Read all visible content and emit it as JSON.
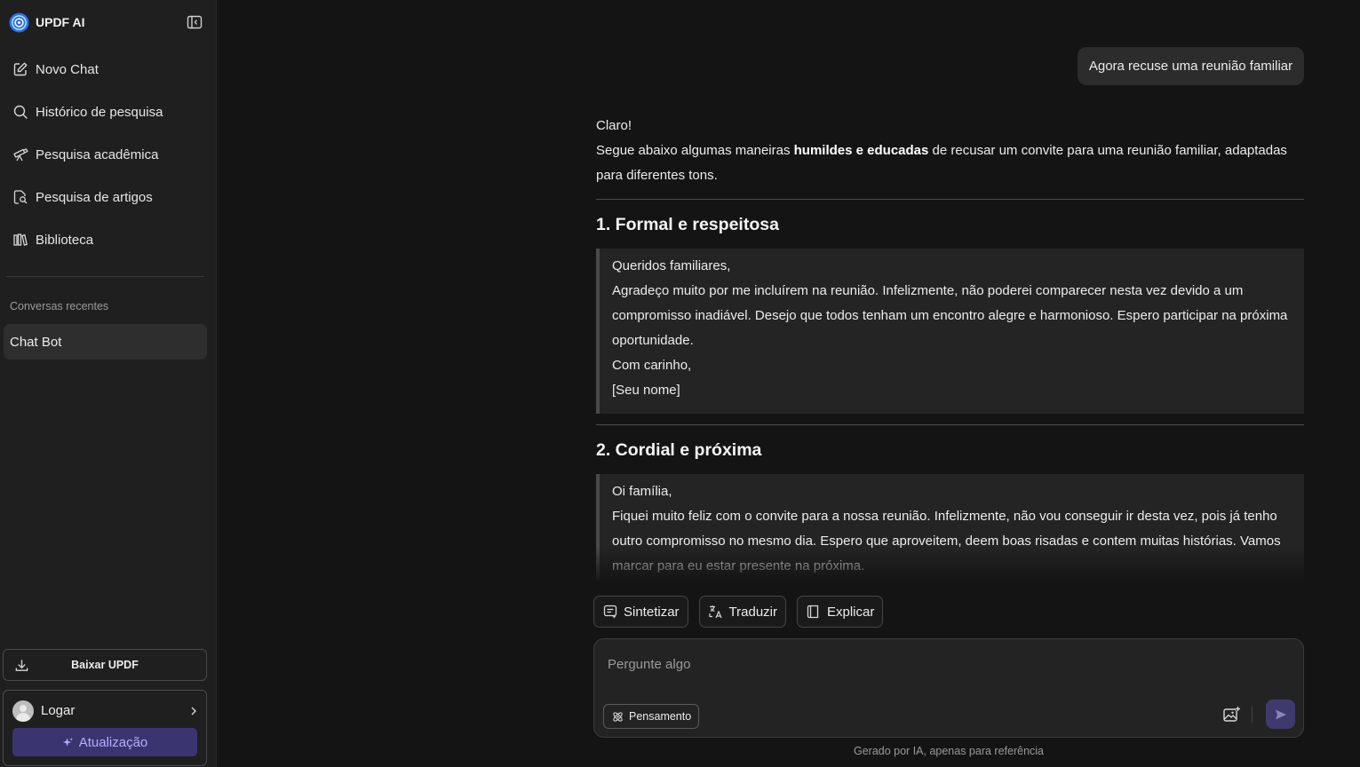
{
  "brand": {
    "name": "UPDF AI"
  },
  "sidebar": {
    "items": [
      {
        "label": "Novo Chat",
        "icon": "edit-icon"
      },
      {
        "label": "Histórico de pesquisa",
        "icon": "search-icon"
      },
      {
        "label": "Pesquisa acadêmica",
        "icon": "telescope-icon"
      },
      {
        "label": "Pesquisa de artigos",
        "icon": "document-search-icon"
      },
      {
        "label": "Biblioteca",
        "icon": "library-icon"
      }
    ],
    "recent_title": "Conversas recentes",
    "recent": [
      {
        "label": "Chat Bot"
      }
    ],
    "download_label": "Baixar UPDF",
    "login_label": "Logar",
    "upgrade_label": "Atualização"
  },
  "chat": {
    "user_message": "Agora recuse uma reunião familiar",
    "answer": {
      "greeting": "Claro!",
      "intro_before": "Segue abaixo algumas maneiras ",
      "intro_bold": "humildes e educadas",
      "intro_after": " de recusar um convite para uma reunião familiar, adaptadas para diferentes tons.",
      "sections": [
        {
          "title": "1. Formal e respeitosa",
          "lines": [
            "Queridos familiares,",
            "Agradeço muito por me incluírem na reunião. Infelizmente, não poderei comparecer nesta vez devido a um compromisso inadiável. Desejo que todos tenham um encontro alegre e harmonioso. Espero participar na próxima oportunidade.",
            "Com carinho,",
            "[Seu nome]"
          ]
        },
        {
          "title": "2. Cordial e próxima",
          "lines": [
            "Oi família,",
            "Fiquei muito feliz com o convite para a nossa reunião. Infelizmente, não vou conseguir ir desta vez, pois já tenho outro compromisso no mesmo dia. Espero que aproveitem, deem boas risadas e contem muitas histórias. Vamos marcar para eu estar presente na próxima."
          ]
        }
      ]
    },
    "tools": [
      {
        "label": "Sintetizar",
        "icon": "summarize-icon"
      },
      {
        "label": "Traduzir",
        "icon": "translate-icon"
      },
      {
        "label": "Explicar",
        "icon": "book-icon"
      }
    ],
    "composer": {
      "placeholder": "Pergunte algo",
      "thinking_label": "Pensamento"
    },
    "footer_note": "Gerado por IA, apenas para referência"
  },
  "colors": {
    "accent": "#3a3570",
    "accent_text": "#b6adff",
    "background": "#141414",
    "sidebar": "#1f1f1f"
  }
}
